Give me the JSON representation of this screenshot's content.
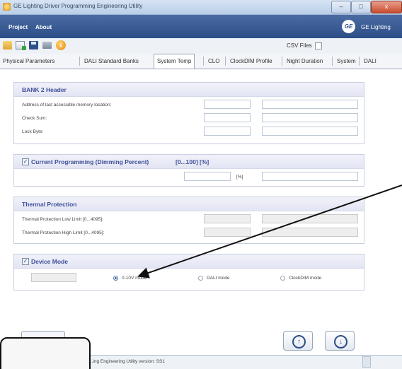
{
  "window": {
    "title": "GE Lighting Driver Programming Engineering Utility",
    "controls": {
      "minimize": "–",
      "maximize": "□",
      "close": "x"
    }
  },
  "menu": {
    "items": [
      "Project",
      "About"
    ],
    "brand": "GE Lighting",
    "brand_logo_text": "GE"
  },
  "toolbar": {
    "icons": [
      "open-folder-icon",
      "export-icon",
      "save-icon",
      "print-icon",
      "info-icon"
    ],
    "info_glyph": "i",
    "csv_label": "CSV Files"
  },
  "tabs": {
    "items": [
      "Physical Parameters",
      "DALI Standard Banks",
      "System Temp",
      "CLO",
      "ClockDIM Profile",
      "Night Duration",
      "System",
      "DALI"
    ],
    "active": "System Temp"
  },
  "bank2": {
    "title": "BANK 2 Header",
    "rows": [
      "Address of last accessible memory location:",
      "Check Sum:",
      "Lock Byte:"
    ]
  },
  "current_programming": {
    "title": "Current Programming (Dimming Percent)",
    "range": "[0...100] [%]",
    "unit": "[%]",
    "checked": true
  },
  "thermal": {
    "title": "Thermal Protection",
    "rows": [
      "Thermal Protection Low Limit [0...4095]:",
      "Thermal Protection High Limit [0...4095]:"
    ]
  },
  "device_mode": {
    "title": "Device Mode",
    "checked": true,
    "options": [
      "0-10V mode",
      "DALI mode",
      "ClockDIM mode"
    ],
    "selected": "0-10V mode"
  },
  "nav": {
    "up_glyph": "↑",
    "down_glyph": "↓"
  },
  "status": {
    "text": "...ing Engineering Utility  version: SS1"
  },
  "colors": {
    "menubar": "#2c4e87",
    "group_title": "#3e4f9a",
    "annotation_arrow": "#111111"
  }
}
